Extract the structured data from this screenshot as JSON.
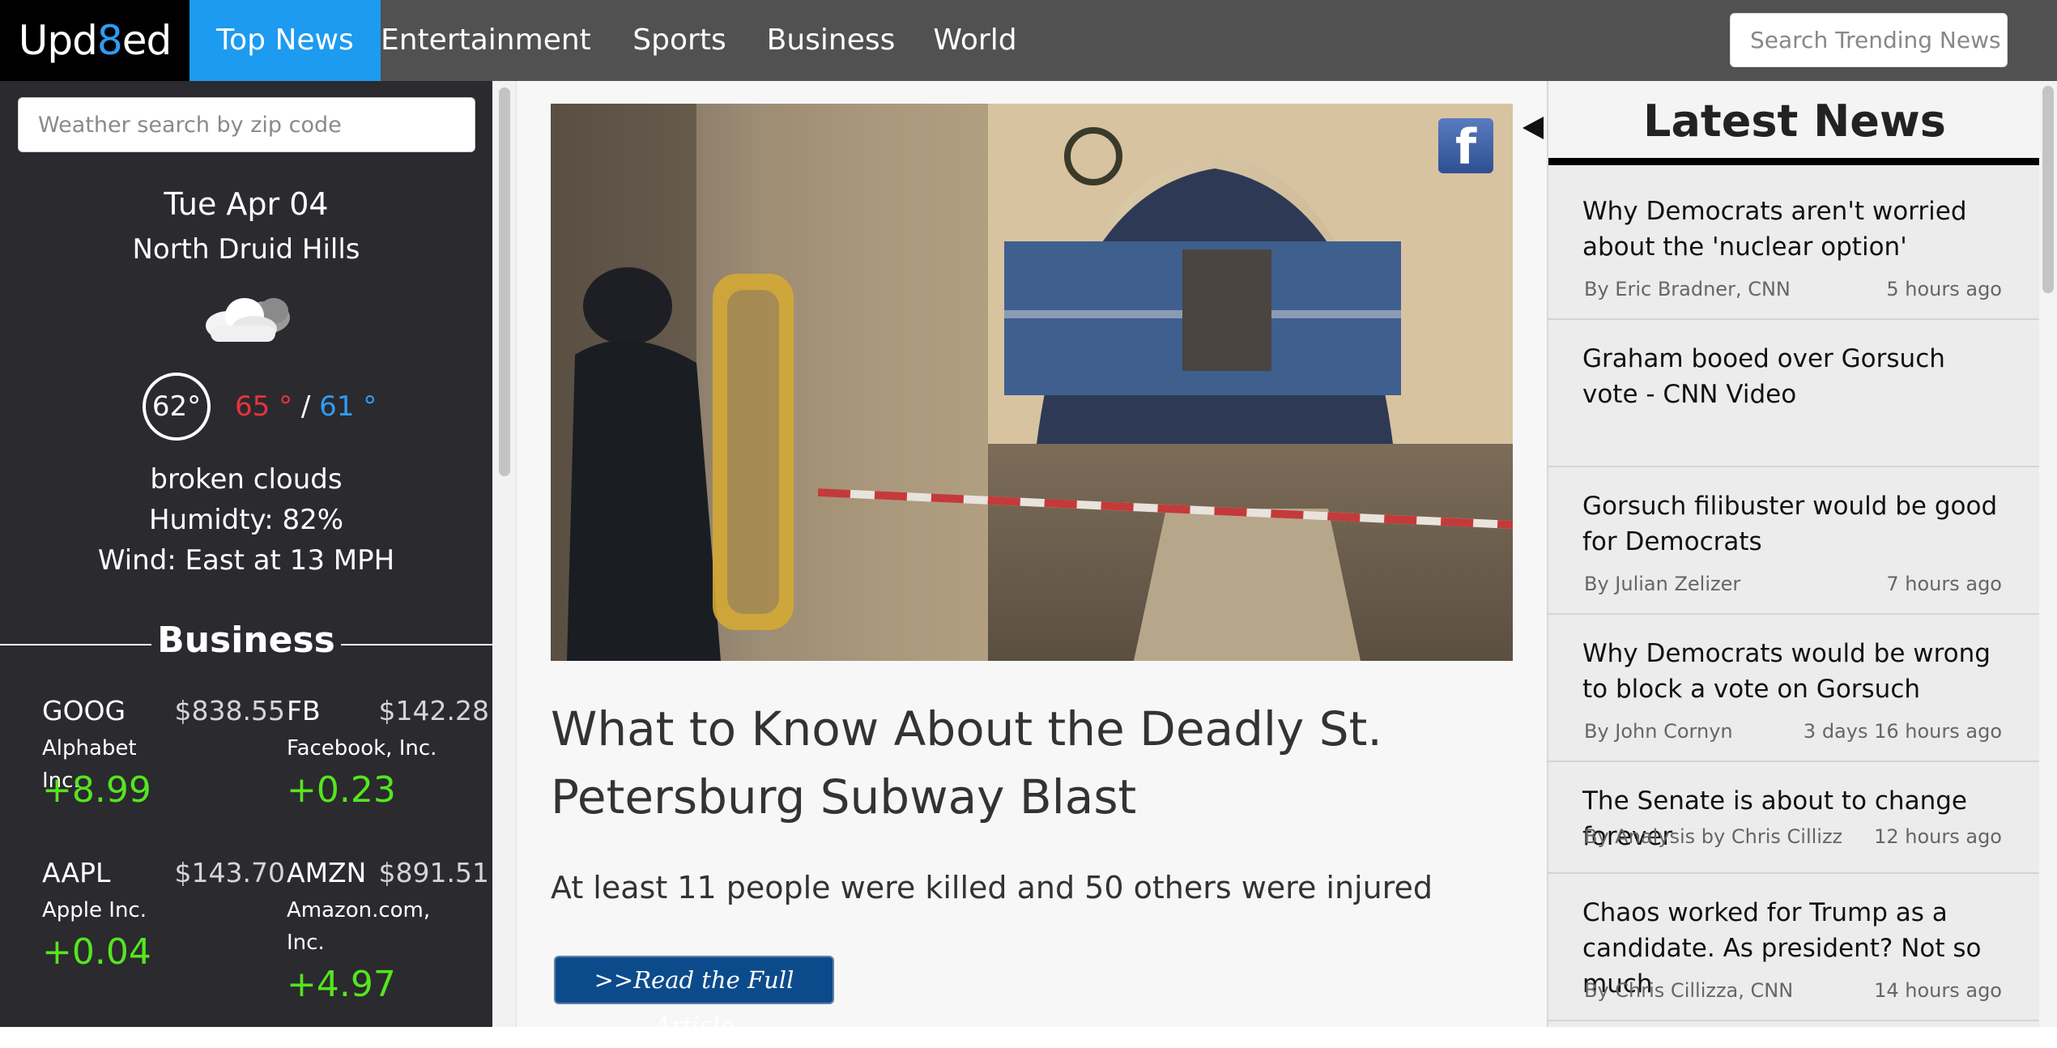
{
  "nav": {
    "logo_pre": "Upd",
    "logo_accent": "8",
    "logo_post": "ed",
    "tabs": [
      {
        "label": "Top News",
        "active": true
      },
      {
        "label": "Entertainment"
      },
      {
        "label": "Sports"
      },
      {
        "label": "Business"
      },
      {
        "label": "World"
      }
    ],
    "search_placeholder": "Search Trending News"
  },
  "weather": {
    "search_placeholder": "Weather search by zip code",
    "date": "Tue Apr 04",
    "city": "North Druid Hills",
    "icon": "cloud-icon",
    "temp": "62°",
    "high": "65 °",
    "sep": "/",
    "low": "61 °",
    "description": "broken clouds",
    "humidity": "Humidty: 82%",
    "wind": "Wind: East at 13 MPH"
  },
  "business": {
    "heading": "Business",
    "stocks": [
      {
        "symbol": "GOOG",
        "price": "$838.55",
        "name": "Alphabet Inc.",
        "change": "+8.99"
      },
      {
        "symbol": "FB",
        "price": "$142.28",
        "name": "Facebook, Inc.",
        "change": "+0.23"
      },
      {
        "symbol": "AAPL",
        "price": "$143.70",
        "name": "Apple Inc.",
        "change": "+0.04"
      },
      {
        "symbol": "AMZN",
        "price": "$891.51",
        "name": "Amazon.com, Inc.",
        "change": "+4.97"
      }
    ]
  },
  "article": {
    "title": "What to Know About the Deadly St. Petersburg Subway Blast",
    "subtitle": "At least 11 people were killed and 50 others were injured",
    "read_button": ">>Read the Full Article",
    "share_icon": "facebook-icon",
    "share_glyph": "f"
  },
  "latest": {
    "title": "Latest News",
    "items": [
      {
        "headline": "Why Democrats aren't worried about the 'nuclear option'",
        "byline": "By Eric Bradner, CNN",
        "ago": "5 hours ago"
      },
      {
        "headline": "Graham booed over Gorsuch vote - CNN Video",
        "byline": "",
        "ago": ""
      },
      {
        "headline": "Gorsuch filibuster would be good for Democrats",
        "byline": "By Julian Zelizer",
        "ago": "7 hours ago"
      },
      {
        "headline": "Why Democrats would be wrong to block a vote on Gorsuch",
        "byline": "By John Cornyn",
        "ago": "3 days 16 hours ago"
      },
      {
        "headline": "The Senate is about to change forever",
        "byline": "By Analysis by Chris Cillizza,...",
        "ago": "12 hours ago"
      },
      {
        "headline": "Chaos worked for Trump as a candidate. As president? Not so much",
        "byline": "By Chris Cillizza, CNN",
        "ago": "14 hours ago"
      }
    ]
  },
  "colors": {
    "nav_bg": "#515151",
    "active_tab": "#1d9bf0",
    "sidebar_bg": "#2b2a2e",
    "stock_up": "#55e51f",
    "temp_high": "#e8333e",
    "temp_low": "#2d9cf5",
    "button_bg": "#0c4b8b"
  }
}
